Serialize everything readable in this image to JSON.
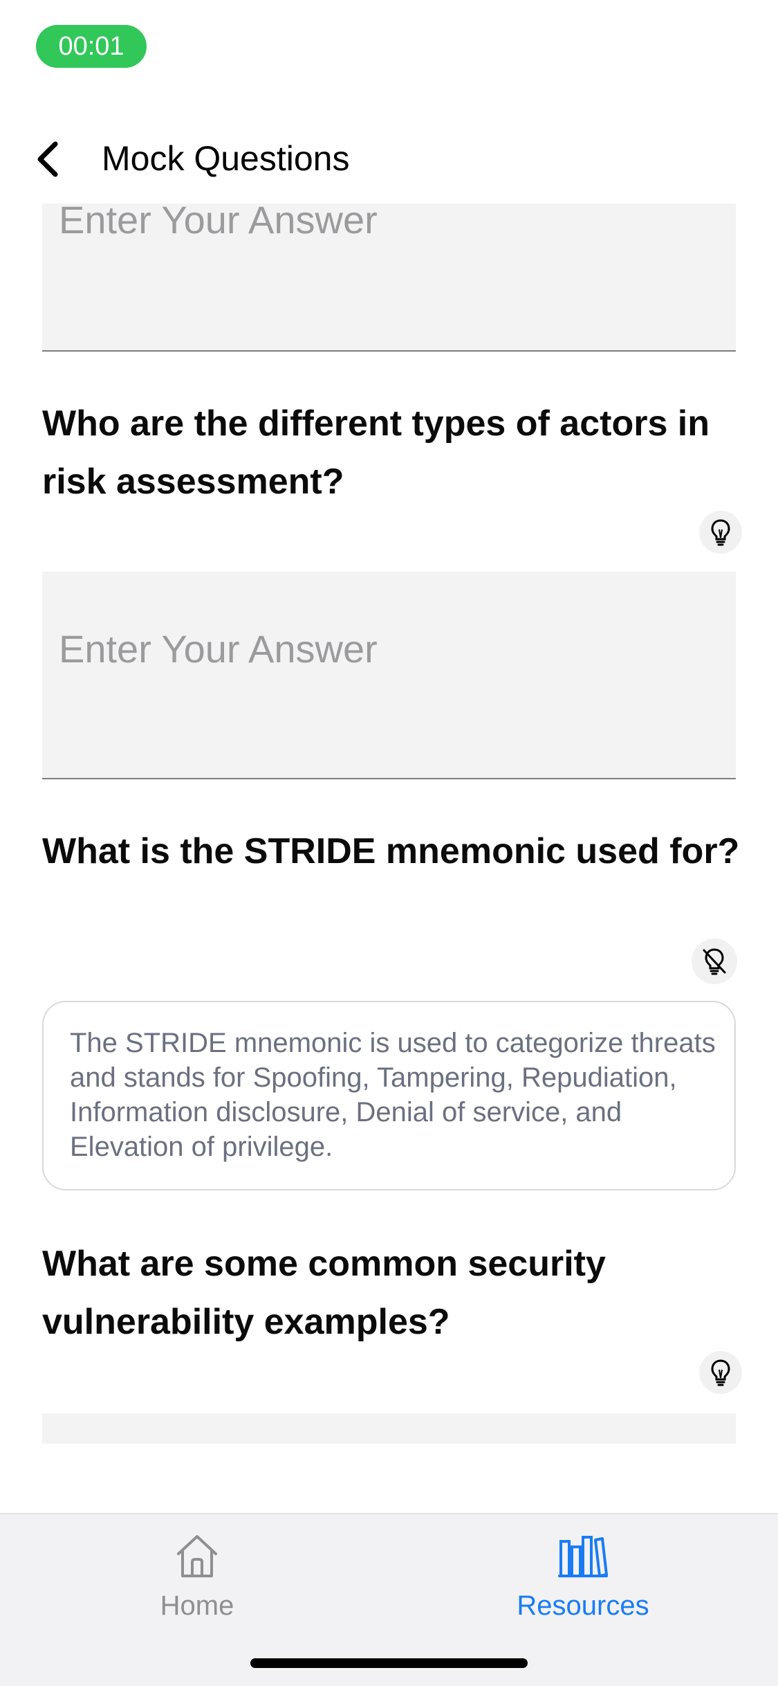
{
  "status_bar": {
    "time": "00:01",
    "pill_color": "#31c759"
  },
  "header": {
    "title": "Mock Questions",
    "back_icon": "chevron-left-icon"
  },
  "questions": [
    {
      "answer_placeholder": "Enter Your Answer"
    },
    {
      "text": "Who are the different types of actors in risk assessment?",
      "answer_placeholder": "Enter Your Answer",
      "hint_icon": "lightbulb-icon"
    },
    {
      "text": "What is the STRIDE mnemonic used for?",
      "hint_icon": "lightbulb-off-icon",
      "answer": "The STRIDE mnemonic is used to categorize threats and stands for Spoofing, Tampering, Repudiation, Information disclosure, Denial of service, and Elevation of privilege."
    },
    {
      "text": "What are some common security vulnerability examples?",
      "hint_icon": "lightbulb-icon"
    }
  ],
  "tabbar": {
    "tabs": [
      {
        "label": "Home",
        "icon": "home-icon",
        "active": false
      },
      {
        "label": "Resources",
        "icon": "books-icon",
        "active": true
      }
    ],
    "active_color": "#1a7cf5",
    "inactive_color": "#8e8e93"
  }
}
